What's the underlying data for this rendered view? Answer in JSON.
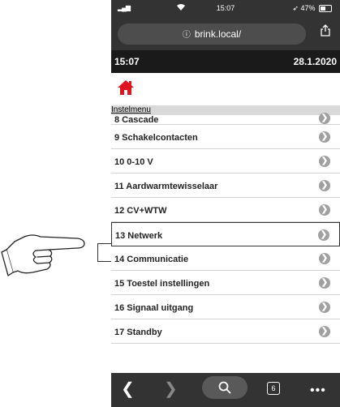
{
  "status_bar": {
    "time": "15:07",
    "battery": "47%"
  },
  "browser": {
    "url": "brink.local/"
  },
  "header": {
    "time": "15:07",
    "date": "28.1.2020"
  },
  "breadcrumb": "Instelmenu",
  "menu_items": [
    "8 Cascade",
    "9 Schakelcontacten",
    "10 0-10 V",
    "11 Aardwarmtewisselaar",
    "12 CV+WTW",
    "13 Netwerk",
    "14 Communicatie",
    "15 Toestel instellingen",
    "16 Signaal uitgang",
    "17 Standby"
  ],
  "toolbar": {
    "tab_count": "6"
  },
  "colors": {
    "home_icon": "#e0141e",
    "dark_bar": "#333333",
    "date_bar": "#1a1a1a",
    "chevron": "#a0a0a0"
  },
  "icons": [
    "signal-icon",
    "wifi-icon",
    "battery-icon",
    "info-icon",
    "share-icon",
    "home-icon",
    "chevron-right-icon",
    "back-icon",
    "forward-icon",
    "search-icon",
    "tabs-icon",
    "more-icon",
    "pointing-hand-icon"
  ]
}
